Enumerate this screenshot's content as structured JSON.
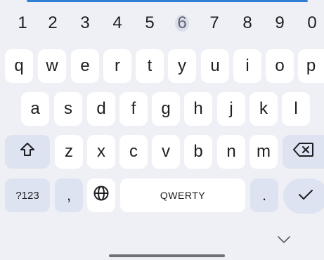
{
  "keyboard": {
    "number_row": [
      "1",
      "2",
      "3",
      "4",
      "5",
      "6",
      "7",
      "8",
      "9",
      "0"
    ],
    "row1": [
      "q",
      "w",
      "e",
      "r",
      "t",
      "y",
      "u",
      "i",
      "o",
      "p"
    ],
    "row2": [
      "a",
      "s",
      "d",
      "f",
      "g",
      "h",
      "j",
      "k",
      "l"
    ],
    "row3": [
      "z",
      "x",
      "c",
      "v",
      "b",
      "n",
      "m"
    ],
    "symbols_label": "?123",
    "comma": ",",
    "space_label": "QWERTY",
    "period": ".",
    "pressed_key": "6",
    "icons": {
      "shift": "shift-arrow-icon",
      "backspace": "backspace-icon",
      "language": "globe-icon",
      "enter": "checkmark-icon",
      "hide": "chevron-down-icon"
    },
    "colors": {
      "background": "#eef0f6",
      "key": "#ffffff",
      "function_key": "#dde3f1",
      "accent": "#2f7fd6"
    }
  }
}
